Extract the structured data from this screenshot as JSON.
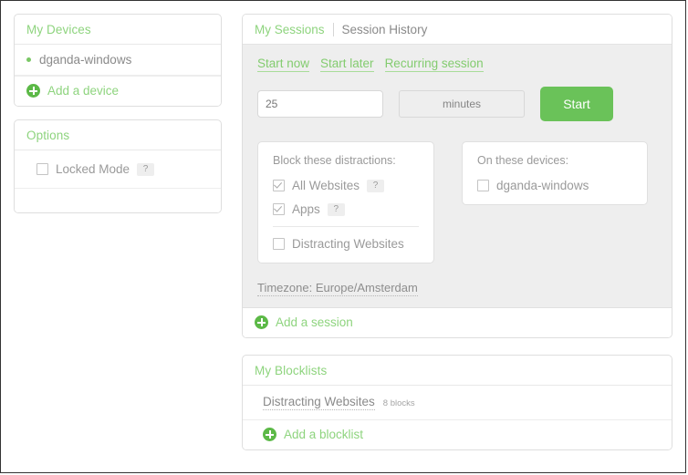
{
  "theme": {
    "accent_green": "#8ed47e",
    "button_green": "#6ac259",
    "body_gray": "#eeeeee",
    "text_gray": "#8a8a8a"
  },
  "devices_card": {
    "title": "My Devices",
    "devices": [
      {
        "name": "dganda-windows"
      }
    ],
    "add_label": "Add a device"
  },
  "options_card": {
    "title": "Options",
    "locked_mode": {
      "label": "Locked Mode",
      "checked": false,
      "help": "?"
    }
  },
  "sessions_card": {
    "tabs": [
      {
        "label": "My Sessions",
        "active": true
      },
      {
        "label": "Session History",
        "active": false
      }
    ],
    "sub_links": [
      {
        "label": "Start now"
      },
      {
        "label": "Start later"
      },
      {
        "label": "Recurring session"
      }
    ],
    "duration": {
      "value": "25",
      "placeholder": "25"
    },
    "unit": {
      "selected": "minutes"
    },
    "start_button": "Start",
    "block_panel": {
      "title": "Block these distractions:",
      "items": [
        {
          "label": "All Websites",
          "checked": true,
          "help": "?"
        },
        {
          "label": "Apps",
          "checked": true,
          "help": "?"
        },
        {
          "label": "Distracting Websites",
          "checked": false,
          "help": ""
        }
      ]
    },
    "device_panel": {
      "title": "On these devices:",
      "items": [
        {
          "label": "dganda-windows",
          "checked": false
        }
      ]
    },
    "timezone": "Timezone: Europe/Amsterdam",
    "add_label": "Add a session"
  },
  "blocklists_card": {
    "title": "My Blocklists",
    "lists": [
      {
        "name": "Distracting Websites",
        "count": "8 blocks"
      }
    ],
    "add_label": "Add a blocklist"
  }
}
